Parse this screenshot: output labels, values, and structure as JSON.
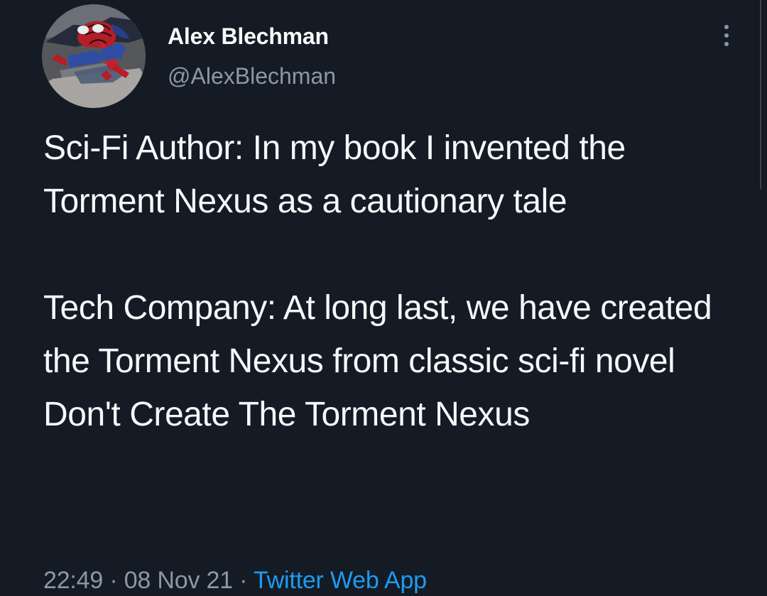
{
  "author": {
    "display_name": "Alex Blechman",
    "handle": "@AlexBlechman"
  },
  "tweet": {
    "paragraphs": [
      "Sci-Fi Author: In my book I invented the Torment Nexus as a cautionary tale",
      "Tech Company: At long last, we have created the Torment Nexus from classic sci-fi novel Don't Create The Torment Nexus"
    ]
  },
  "meta": {
    "time": "22:49",
    "separator_1": "·",
    "date": "08 Nov 21",
    "separator_2": "·",
    "source": "Twitter Web App"
  },
  "icons": {
    "avatar": "spiderman-profile-image",
    "menu": "more-options-icon"
  },
  "colors": {
    "background": "#141b24",
    "primary_text": "#f5f8fa",
    "secondary_text": "#8b98a5",
    "link": "#1d9bf0"
  }
}
